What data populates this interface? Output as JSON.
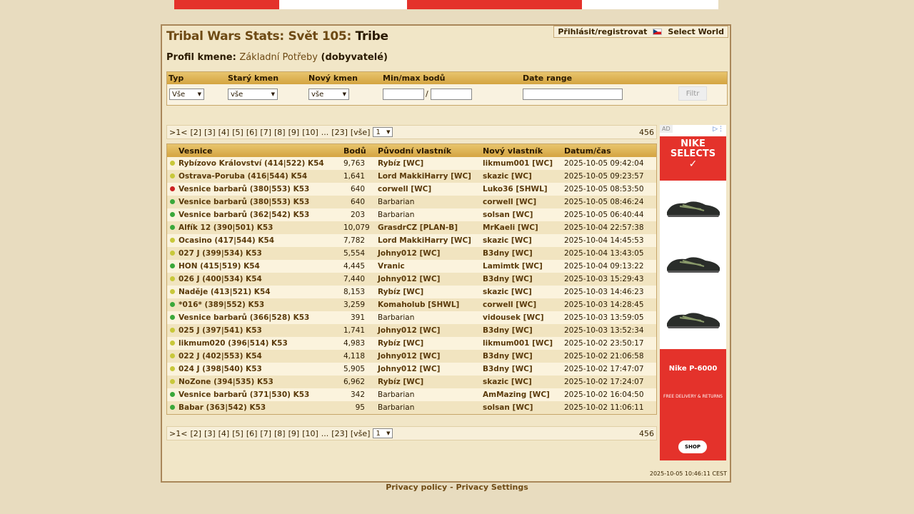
{
  "banner": {
    "colors": [
      "#e4322b",
      "#ffffff",
      "#e4322b",
      "#ffffff"
    ]
  },
  "header": {
    "title_prefix": "Tribal Wars Stats: Svět 105:",
    "title_suffix": "Tribe",
    "login": "Přihlásit/registrovat",
    "select_world": "Select World"
  },
  "profile": {
    "label": "Profil kmene:",
    "tribe": "Základní Potřeby",
    "tag": "(dobyvatelé)"
  },
  "filter": {
    "headers": {
      "typ": "Typ",
      "stary": "Starý kmen",
      "novy": "Nový kmen",
      "body": "Min/max bodů",
      "date": "Date range"
    },
    "typ_value": "Vše",
    "stary_value": "vše",
    "novy_value": "vše",
    "slash": "/",
    "button": "Filtr"
  },
  "pager": {
    "current": ">1<",
    "pages": [
      "[2]",
      "[3]",
      "[4]",
      "[5]",
      "[6]",
      "[7]",
      "[8]",
      "[9]",
      "[10]",
      "...",
      "[23]",
      "[vše]"
    ],
    "select": "1",
    "count": "456"
  },
  "table": {
    "headers": {
      "village": "Vesnice",
      "points": "Bodů",
      "old": "Původní vlastník",
      "new": "Nový vlastník",
      "date": "Datum/čas"
    },
    "rows": [
      {
        "dot": "#c8c83a",
        "village": "Rybízovo Království (414|522) K54",
        "points": "9,763",
        "old": "Rybíz [WC]",
        "old_link": true,
        "new": "likmum001 [WC]",
        "date": "2025-10-05 09:42:04"
      },
      {
        "dot": "#c8c83a",
        "village": "Ostrava-Poruba (416|544) K54",
        "points": "1,641",
        "old": "Lord MakkiHarry [WC]",
        "old_link": true,
        "new": "skazic [WC]",
        "date": "2025-10-05 09:23:57"
      },
      {
        "dot": "#cc2222",
        "village": "Vesnice barbarů (380|553) K53",
        "points": "640",
        "old": "corwell [WC]",
        "old_link": true,
        "new": "Luko36 [SHWL]",
        "date": "2025-10-05 08:53:50"
      },
      {
        "dot": "#3aa83a",
        "village": "Vesnice barbarů (380|553) K53",
        "points": "640",
        "old": "Barbarian",
        "old_link": false,
        "new": "corwell [WC]",
        "date": "2025-10-05 08:46:24"
      },
      {
        "dot": "#3aa83a",
        "village": "Vesnice barbarů (362|542) K53",
        "points": "203",
        "old": "Barbarian",
        "old_link": false,
        "new": "solsan [WC]",
        "date": "2025-10-05 06:40:44"
      },
      {
        "dot": "#3aa83a",
        "village": "Alfík 12 (390|501) K53",
        "points": "10,079",
        "old": "GrasdrCZ [PLAN-B]",
        "old_link": true,
        "new": "MrKaeli [WC]",
        "date": "2025-10-04 22:57:38"
      },
      {
        "dot": "#c8c83a",
        "village": "Ocasino (417|544) K54",
        "points": "7,782",
        "old": "Lord MakkiHarry [WC]",
        "old_link": true,
        "new": "skazic [WC]",
        "date": "2025-10-04 14:45:53"
      },
      {
        "dot": "#c8c83a",
        "village": "027 J (399|534) K53",
        "points": "5,554",
        "old": "Johny012 [WC]",
        "old_link": true,
        "new": "B3dny [WC]",
        "date": "2025-10-04 13:43:05"
      },
      {
        "dot": "#3aa83a",
        "village": "HON (415|519) K54",
        "points": "4,445",
        "old": "Vranic",
        "old_link": true,
        "new": "Lamimtk [WC]",
        "date": "2025-10-04 09:13:22"
      },
      {
        "dot": "#c8c83a",
        "village": "026 J (400|534) K54",
        "points": "7,440",
        "old": "Johny012 [WC]",
        "old_link": true,
        "new": "B3dny [WC]",
        "date": "2025-10-03 15:29:43"
      },
      {
        "dot": "#c8c83a",
        "village": "Naděje (413|521) K54",
        "points": "8,153",
        "old": "Rybíz [WC]",
        "old_link": true,
        "new": "skazic [WC]",
        "date": "2025-10-03 14:46:23"
      },
      {
        "dot": "#3aa83a",
        "village": "*016* (389|552) K53",
        "points": "3,259",
        "old": "Komaholub [SHWL]",
        "old_link": true,
        "new": "corwell [WC]",
        "date": "2025-10-03 14:28:45"
      },
      {
        "dot": "#3aa83a",
        "village": "Vesnice barbarů (366|528) K53",
        "points": "391",
        "old": "Barbarian",
        "old_link": false,
        "new": "vidousek [WC]",
        "date": "2025-10-03 13:59:05"
      },
      {
        "dot": "#c8c83a",
        "village": "025 J (397|541) K53",
        "points": "1,741",
        "old": "Johny012 [WC]",
        "old_link": true,
        "new": "B3dny [WC]",
        "date": "2025-10-03 13:52:34"
      },
      {
        "dot": "#c8c83a",
        "village": "likmum020 (396|514) K53",
        "points": "4,983",
        "old": "Rybíz [WC]",
        "old_link": true,
        "new": "likmum001 [WC]",
        "date": "2025-10-02 23:50:17"
      },
      {
        "dot": "#c8c83a",
        "village": "022 J (402|553) K54",
        "points": "4,118",
        "old": "Johny012 [WC]",
        "old_link": true,
        "new": "B3dny [WC]",
        "date": "2025-10-02 21:06:58"
      },
      {
        "dot": "#c8c83a",
        "village": "024 J (398|540) K53",
        "points": "5,905",
        "old": "Johny012 [WC]",
        "old_link": true,
        "new": "B3dny [WC]",
        "date": "2025-10-02 17:47:07"
      },
      {
        "dot": "#c8c83a",
        "village": "NoZone (394|535) K53",
        "points": "6,962",
        "old": "Rybíz [WC]",
        "old_link": true,
        "new": "skazic [WC]",
        "date": "2025-10-02 17:24:07"
      },
      {
        "dot": "#3aa83a",
        "village": "Vesnice barbarů (371|530) K53",
        "points": "342",
        "old": "Barbarian",
        "old_link": false,
        "new": "AmMazing [WC]",
        "date": "2025-10-02 16:04:50"
      },
      {
        "dot": "#3aa83a",
        "village": "Babar (363|542) K53",
        "points": "95",
        "old": "Barbarian",
        "old_link": false,
        "new": "solsan [WC]",
        "date": "2025-10-02 11:06:11"
      }
    ]
  },
  "ad": {
    "tag": "AD",
    "headline": "NIKE SELECTS",
    "product": "Nike P-6000",
    "shipping": "FREE DELIVERY & RETURNS",
    "cta": "SHOP"
  },
  "timestamp": "2025-10-05 10:46:11 CEST",
  "footer": {
    "privacy": "Privacy policy",
    "sep": "-",
    "settings": "Privacy Settings"
  }
}
